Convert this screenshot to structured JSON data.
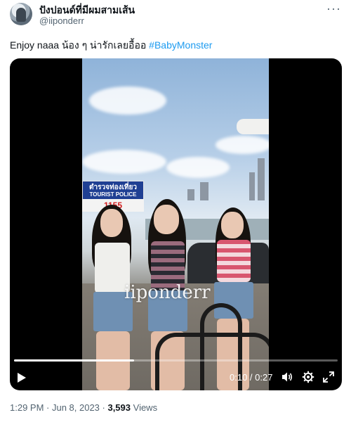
{
  "author": {
    "display_name": "ปังปอนด์ที่มีผมสามเส้น",
    "handle": "@iiponderr"
  },
  "post": {
    "text": "Enjoy naaa น้อง ๆ น่ารักเลยอื้ออ",
    "hashtag": "#BabyMonster",
    "timestamp": "1:29 PM · Jun 8, 2023 · ",
    "views_count": "3,593",
    "views_label": " Views"
  },
  "video": {
    "watermark": "iiponderr",
    "sign_title": "ตำรวจท่องเที่ยว",
    "sign_subtitle": "TOURIST POLICE",
    "sign_number": "1155",
    "current_time": "0:10",
    "time_separator": " / ",
    "duration": "0:27",
    "progress_fraction": 0.37
  },
  "icons": {
    "more": "more-horizontal-icon",
    "play": "play-icon",
    "volume": "volume-icon",
    "settings": "gear-icon",
    "fullscreen": "fullscreen-icon"
  },
  "colors": {
    "link": "#1d9bf0",
    "text_secondary": "#536471",
    "text_primary": "#0f1419"
  }
}
